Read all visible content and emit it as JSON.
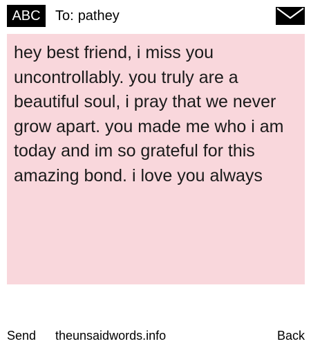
{
  "header": {
    "abc_label": "ABC",
    "to_label": "To:",
    "recipient": "pathey",
    "icon": "envelope-icon"
  },
  "message": {
    "text": "hey best friend, i miss you uncontrollably. you truly are a beautiful soul, i pray that we never grow apart. you made me who i am today and im so grateful for this amazing bond. i love you always",
    "background_color": "#f9d7dc"
  },
  "footer": {
    "send_label": "Send",
    "site": "theunsaidwords.info",
    "back_label": "Back"
  }
}
